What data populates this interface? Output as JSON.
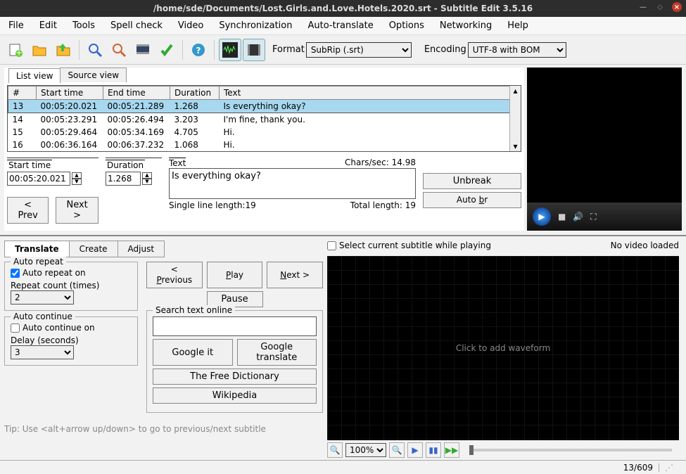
{
  "window": {
    "title": "/home/sde/Documents/Lost.Girls.and.Love.Hotels.2020.srt - Subtitle Edit 3.5.16"
  },
  "menu": [
    "File",
    "Edit",
    "Tools",
    "Spell check",
    "Video",
    "Synchronization",
    "Auto-translate",
    "Options",
    "Networking",
    "Help"
  ],
  "toolbar": {
    "format_label": "Format",
    "format_value": "SubRip (.srt)",
    "encoding_label": "Encoding",
    "encoding_value": "UTF-8 with BOM"
  },
  "view_tabs": {
    "list": "List view",
    "source": "Source view"
  },
  "columns": {
    "num": "#",
    "start": "Start time",
    "end": "End time",
    "dur": "Duration",
    "text": "Text"
  },
  "rows": [
    {
      "n": "13",
      "start": "00:05:20.021",
      "end": "00:05:21.289",
      "dur": "1.268",
      "text": "Is everything okay?"
    },
    {
      "n": "14",
      "start": "00:05:23.291",
      "end": "00:05:26.494",
      "dur": "3.203",
      "text": "I'm fine, thank you."
    },
    {
      "n": "15",
      "start": "00:05:29.464",
      "end": "00:05:34.169",
      "dur": "4.705",
      "text": "Hi."
    },
    {
      "n": "16",
      "start": "00:06:36.164",
      "end": "00:06:37.232",
      "dur": "1.068",
      "text": "Hi."
    }
  ],
  "editor": {
    "start_label": "Start time",
    "start_value": "00:05:20.021",
    "dur_label": "Duration",
    "dur_value": "1.268",
    "text_label": "Text",
    "text_value": "Is everything okay?",
    "cps_label": "Chars/sec: 14.98",
    "single_len": "Single line length:19",
    "total_len": "Total length: 19",
    "unbreak": "Unbreak",
    "autobr_pre": "Auto ",
    "autobr_u": "b",
    "autobr_post": "r",
    "prev": "< Prev",
    "next": "Next >"
  },
  "lower_tabs": {
    "translate": "Translate",
    "create": "Create",
    "adjust": "Adjust"
  },
  "auto_repeat": {
    "legend": "Auto repeat",
    "on": "Auto repeat on",
    "count_label": "Repeat count (times)",
    "count_value": "2"
  },
  "auto_continue": {
    "legend": "Auto continue",
    "on": "Auto continue on",
    "delay_label": "Delay (seconds)",
    "delay_value": "3"
  },
  "playback": {
    "previous_pre": "< ",
    "previous_u": "P",
    "previous_post": "revious",
    "play_u": "P",
    "play_post": "lay",
    "next_u": "N",
    "next_post": "ext >",
    "pause": "Pause"
  },
  "search": {
    "legend": "Search text online",
    "google": "Google it",
    "gtranslate": "Google translate",
    "freedict": "The Free Dictionary",
    "wikipedia": "Wikipedia"
  },
  "tip": "Tip: Use <alt+arrow up/down> to go to previous/next subtitle",
  "wave": {
    "select_cb": "Select current subtitle while playing",
    "no_video": "No video loaded",
    "placeholder": "Click to add waveform",
    "zoom": "100%"
  },
  "status": {
    "position": "13/609"
  }
}
